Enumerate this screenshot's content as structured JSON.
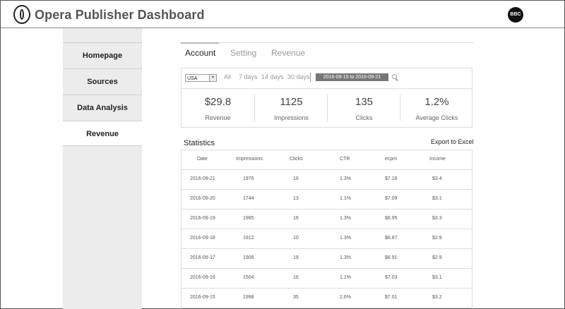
{
  "header": {
    "title": "Opera Publisher Dashboard",
    "avatar_text": "BBC"
  },
  "sidebar": {
    "items": [
      {
        "label": "Homepage"
      },
      {
        "label": "Sources"
      },
      {
        "label": "Data Analysis"
      },
      {
        "label": "Revenue"
      }
    ],
    "active": "Revenue"
  },
  "tabs": [
    {
      "label": "Account"
    },
    {
      "label": "Setting"
    },
    {
      "label": "Revenue"
    }
  ],
  "filters": {
    "country": "USA",
    "ranges": [
      "All",
      "7 days",
      "14 days",
      "30 days"
    ],
    "date_range": "2016-09-15  to  2016-09-21"
  },
  "metrics": [
    {
      "value": "$29.8",
      "label": "Revenue"
    },
    {
      "value": "1125",
      "label": "Impressions"
    },
    {
      "value": "135",
      "label": "Clicks"
    },
    {
      "value": "1.2%",
      "label": "Average Clicks"
    }
  ],
  "statistics": {
    "title": "Statistics",
    "export_label": "Export to Excel",
    "columns": [
      "Date",
      "Impressions",
      "Clicks",
      "CTR",
      "ecpm",
      "Income"
    ],
    "rows": [
      [
        "2016-09-21",
        "1976",
        "16",
        "1.3%",
        "$7.16",
        "$3.4"
      ],
      [
        "2016-09-20",
        "1744",
        "13",
        "1.1%",
        "$7.09",
        "$3.1"
      ],
      [
        "2016-09-19",
        "1985",
        "16",
        "1.3%",
        "$6.95",
        "$3.3"
      ],
      [
        "2016-09-18",
        "1912",
        "10",
        "1.3%",
        "$6.87",
        "$2.9"
      ],
      [
        "2016-09-17",
        "1909",
        "19",
        "1.3%",
        "$6.91",
        "$2.9"
      ],
      [
        "2016-09-16",
        "1504",
        "16",
        "1.1%",
        "$7.03",
        "$3.1"
      ],
      [
        "2016-09-15",
        "1998",
        "35",
        "2.6%",
        "$7.01",
        "$3.2"
      ]
    ]
  }
}
